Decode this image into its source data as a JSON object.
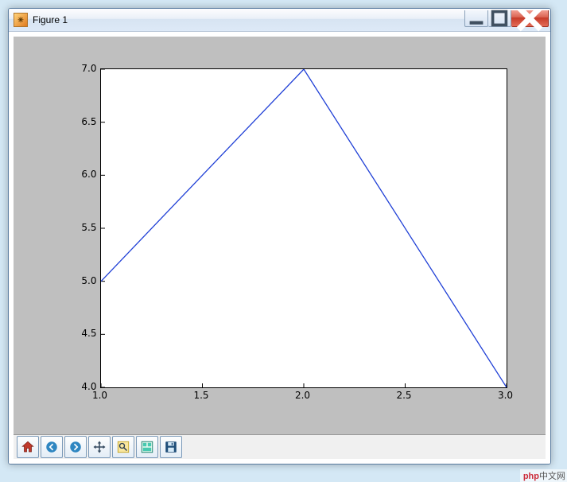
{
  "window": {
    "title": "Figure 1"
  },
  "chart_data": {
    "type": "line",
    "x": [
      1.0,
      2.0,
      3.0
    ],
    "y": [
      5.0,
      7.0,
      4.0
    ],
    "xlim": [
      1.0,
      3.0
    ],
    "ylim": [
      4.0,
      7.0
    ],
    "xticks": [
      1.0,
      1.5,
      2.0,
      2.5,
      3.0
    ],
    "yticks": [
      4.0,
      4.5,
      5.0,
      5.5,
      6.0,
      6.5,
      7.0
    ],
    "xtick_labels": [
      "1.0",
      "1.5",
      "2.0",
      "2.5",
      "3.0"
    ],
    "ytick_labels": [
      "4.0",
      "4.5",
      "5.0",
      "5.5",
      "6.0",
      "6.5",
      "7.0"
    ],
    "title": "",
    "xlabel": "",
    "ylabel": "",
    "line_color": "#1f3fd6"
  },
  "toolbar": {
    "home": "Home",
    "back": "Back",
    "forward": "Forward",
    "pan": "Pan",
    "zoom": "Zoom",
    "config": "Configure subplots",
    "save": "Save"
  },
  "watermark": {
    "brand": "php",
    "text": "中文网"
  }
}
